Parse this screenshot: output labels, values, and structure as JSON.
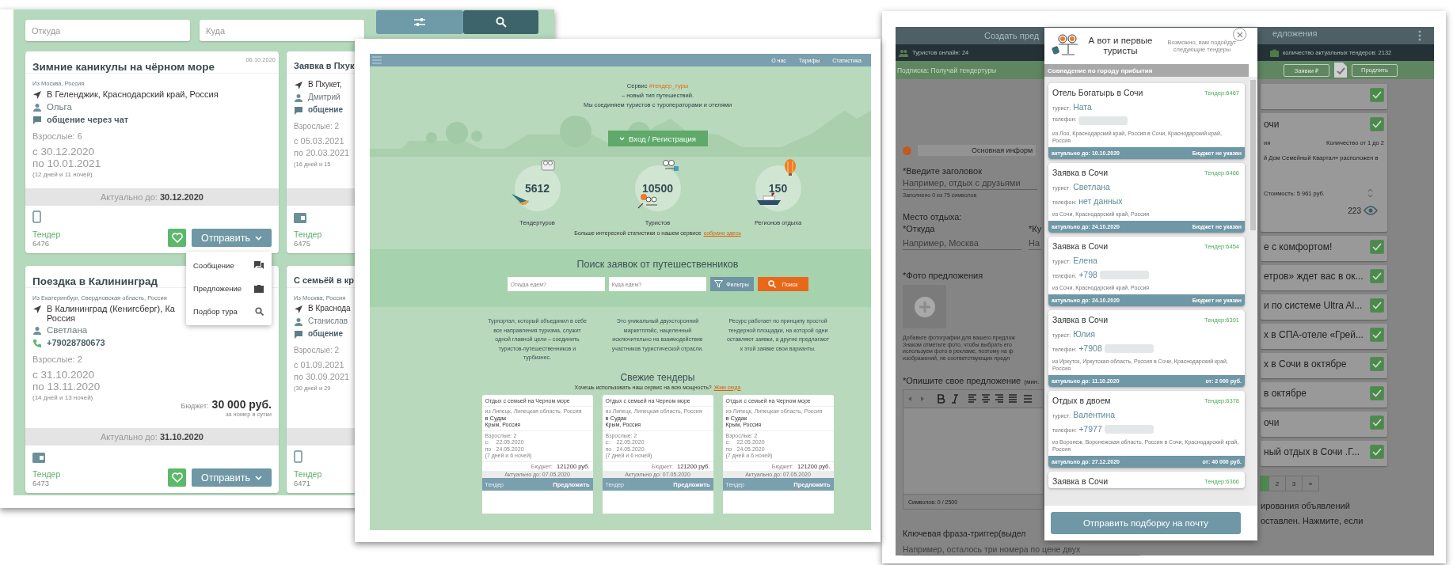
{
  "left_window": {
    "search": {
      "from_placeholder": "Откуда",
      "to_placeholder": "Куда"
    },
    "cards_column_1": [
      {
        "title": "Зимние каникулы на чёрном море",
        "date": "06.10.2020",
        "from": "Из Москва, Россия",
        "to_lines": [
          "В Геленджик, Краснодарский край, Россия"
        ],
        "tourist": "Ольга",
        "contact": {
          "kind": "chat",
          "text": "общение через чат"
        },
        "adults": "Взрослые: 6",
        "date_from": "с 30.12.2020",
        "date_to": "по 10.01.2021",
        "duration": "(12 дней и 11 ночей)",
        "actual_label": "Актуально до:",
        "actual_until": "30.12.2020",
        "source": {
          "kind": "mobile"
        },
        "tender_label": "Тендер",
        "tender_number": "6476",
        "send_label": "Отправить"
      },
      {
        "title": "Поездка в Калининград",
        "from": "Из Екатеринбург, Свердловская область, Россия",
        "to_lines": [
          "В Калининград (Кенигсберг), Ка",
          "Россия"
        ],
        "tourist": "Светлана",
        "contact": {
          "kind": "phone",
          "text": "+79028780673"
        },
        "adults": "Взрослые: 2",
        "date_from": "с 31.10.2020",
        "date_to": "по 13.11.2020",
        "duration": "(14 дней и 13 ночей)",
        "budget_label": "Бюджет:",
        "budget": "30 000 руб.",
        "budget_note": "за номер в сутки",
        "actual_label": "Актуально до:",
        "actual_until": "31.10.2020",
        "source": {
          "kind": "web"
        },
        "tender_label": "Тендер",
        "tender_number": "6473",
        "send_label": "Отправить"
      }
    ],
    "cards_column_2": [
      {
        "title": "Заявка в Пхук",
        "to_lines": [
          "В Пхукет,"
        ],
        "tourist": "Дмитрий",
        "contact": {
          "kind": "chat",
          "text": "общение"
        },
        "adults": "Взрослые: 2",
        "date_from": "с 05.03.2021",
        "date_to": "по 20.03.2021",
        "duration": "(16 дней и 15",
        "source": {
          "kind": "web"
        },
        "tender_label": "Тендер",
        "tender_number": "6475"
      },
      {
        "title": "С семьёй в кр",
        "from": "Из Москва, Россия",
        "to_lines": [
          "В Краснода"
        ],
        "tourist": "Станислав",
        "contact": {
          "kind": "chat",
          "text": "общение"
        },
        "adults": "Взрослые: 2",
        "date_from": "с 01.09.2021",
        "date_to": "по 30.09.2021",
        "duration": "(30 дней и 29",
        "source": {
          "kind": "mobile"
        },
        "tender_label": "Тендер",
        "tender_number": "6471"
      }
    ],
    "send_menu": [
      {
        "label": "Сообщение",
        "kind": "message"
      },
      {
        "label": "Предложение",
        "kind": "offer"
      },
      {
        "label": "Подбор тура",
        "kind": "search"
      }
    ]
  },
  "middle_window": {
    "nav_links": [
      "О нас",
      "Тарифы",
      "Статистика"
    ],
    "intro_prefix": "Сервис",
    "intro_tag": "#тендер_туры",
    "intro_lines": [
      "– новый тип путешествий.",
      "Мы соединяем туристов с туроператорами и отелями"
    ],
    "login_button": "Вход / Регистрация",
    "stats": [
      {
        "value": "5612",
        "label": "Тендертуров",
        "kind": "tenders"
      },
      {
        "value": "10500",
        "label": "Туристов",
        "kind": "tourists"
      },
      {
        "value": "150",
        "label": "Регионов отдыха",
        "kind": "regions"
      }
    ],
    "stats_note": "Больше интересной статистики о нашем сервисе",
    "stats_link": "собрано здесь",
    "search": {
      "title": "Поиск заявок от путешественников",
      "from_placeholder": "Откуда едем?",
      "to_placeholder": "Куда едем?",
      "filters_button": "Фильтры",
      "search_button": "Поиск"
    },
    "features": [
      "Турпортал, который объединил в себе все направления туризма, служит одной главной цели – соединить туристов-путешественников и турбизнес.",
      "Это уникальный двухсторонний маркетплэйс, нацеленный исключительно на взаимодействие участников туристической отрасли.",
      "Ресурс работает по принципу простой тендерной площадки, на которой одни оставляют заявки, а другие предлагают к этой заявке свои варианты."
    ],
    "fresh_title": "Свежие тендеры",
    "fresh_note": "Хочешь использовать наш сервис на всю мощность?",
    "fresh_link": "Жми сюда",
    "tenders": [
      {
        "title": "Отдых с семьей на Черном море",
        "from": "из Липецк, Липецкая область, Россия",
        "to": "в Судак",
        "region": "Крым, Россия",
        "adults": "Взрослые: 2",
        "from_label": "с:",
        "date_from": "22.05.2020",
        "to_label": "по",
        "date_to": "24.05.2020",
        "duration": "(7 дней и 6 ночей)",
        "budget_label": "Бюджет:",
        "budget": "121200 руб.",
        "actual": "Актуально до: 07.05.2020",
        "tender_label": "Тендер",
        "offer_button": "Предложить"
      },
      {
        "title": "Отдых с семьей на Черном море",
        "from": "из Липецк, Липецкая область, Россия",
        "to": "в Судак",
        "region": "Крым, Россия",
        "adults": "Взрослые: 2",
        "from_label": "с:",
        "date_from": "22.05.2020",
        "to_label": "по",
        "date_to": "24.05.2020",
        "duration": "(7 дней и 6 ночей)",
        "budget_label": "Бюджет:",
        "budget": "121200 руб.",
        "actual": "Актуально до: 07.05.2020",
        "tender_label": "Тендер",
        "offer_button": "Предложить"
      },
      {
        "title": "Отдых с семьей на Черном море",
        "from": "из Липецк, Липецкая область, Россия",
        "to": "в Судак",
        "region": "Крым, Россия",
        "adults": "Взрослые: 2",
        "from_label": "с:",
        "date_from": "22.05.2020",
        "to_label": "по",
        "date_to": "24.05.2020",
        "duration": "(7 дней и 6 ночей)",
        "budget_label": "Бюджет:",
        "budget": "121200 руб.",
        "actual": "Актуально до: 07.05.2020",
        "tender_label": "Тендер",
        "offer_button": "Предложить"
      }
    ]
  },
  "right_window": {
    "tabs": [
      "Создать пред",
      "едложения"
    ],
    "online": "Туристов онлайн: 24",
    "tenders_count": "количество актуальных тендеров: 2132",
    "subscription": "Подписка: Получай тендертуры",
    "requests_button": "Заявки ₽",
    "extend_button": "Продлить",
    "form": {
      "section": "Основная информ",
      "title_label": "*Введите заголовок",
      "title_placeholder": "Например, отдых с друзьями",
      "title_counter": "Заполнено 0 из 75 символов",
      "place_label": "Место отдыха:",
      "from_label": "*Откуда",
      "to_label": "*Ку",
      "from_placeholder": "Например, Москва",
      "to_placeholder": "На",
      "photo_label": "*Фото предложения",
      "photo_help": [
        "Добавьте фотографии для вашего предлож",
        "Знаком отметьте фото, чтобы выбрать его",
        "используем фото в рекламе, поэтому на ф",
        "изображений, не соответствующих предл"
      ],
      "description_label": "*Опишите свое предложение",
      "description_hint": "(мин.",
      "char_counter": "Символов: 0 / 2500",
      "keyphrase_label": "Ключевая фраза-триггер(выдел",
      "keyphrase_placeholder": "Например, осталось три номера по цене двух"
    },
    "list_items": [
      {
        "checked": true
      },
      {
        "title": "очи",
        "checked": true,
        "kind": "detailed",
        "subtitle": "ия",
        "quantity": "Количество от 1 до 2",
        "description": "й Дом Семейный Квартал» расположен в",
        "price": "Стоимость: 5 961 руб.",
        "views": "223"
      },
      {
        "title": "е с комфортом!",
        "checked": true
      },
      {
        "title": "етров» ждет вас в ок...",
        "checked": true
      },
      {
        "title": "и по системе Ultra Al...",
        "checked": true
      },
      {
        "title": "х в СПА-отеле «Грей...",
        "checked": true
      },
      {
        "title": "х в Сочи в октябре",
        "checked": true
      },
      {
        "title": "в октябре",
        "checked": true
      },
      {
        "title": "очи",
        "checked": true
      },
      {
        "title": "ный отдых в Сочи .Г...",
        "checked": true
      }
    ],
    "pages": [
      {
        "selected": true
      },
      {
        "label": "2",
        "selected": false
      },
      {
        "label": "3",
        "selected": false
      },
      {
        "label": "»",
        "selected": false
      }
    ],
    "bottom_lines": [
      "ирования объявлений",
      "оставлен. Нажмите, если"
    ],
    "modal": {
      "title": "А вот и первые туристы",
      "note": "Возможно, вам подойдут следующие тендеры",
      "section": "Совпадение по городу прибытия",
      "button": "Отправить подборку на почту",
      "cards": [
        {
          "title": "Отель Богатырь в Сочи",
          "tender": "Тендер:6467",
          "tourist_label": "турист:",
          "tourist": "Ната",
          "phone_label": "телефон:",
          "phone_blurred": true,
          "route": "из Лоо, Краснодарский край, Россия в Сочи, Краснодарский край, Россия",
          "actual": "актуально до: 10.10.2020",
          "budget": "Бюджет не указан"
        },
        {
          "title": "Заявка в Сочи",
          "tender": "Тендер:6466",
          "tourist_label": "турист:",
          "tourist": "Светлана",
          "phone_label": "телефон:",
          "phone": "нет данных",
          "phone_blurred": false,
          "route": "из Сочи, Краснодарский край, Россия",
          "actual": "актуально до: 24.10.2020",
          "budget": "Бюджет не указан"
        },
        {
          "title": "Заявка в Сочи",
          "tender": "Тендер:6454",
          "tourist_label": "турист:",
          "tourist": "Елена",
          "phone_label": "телефон:",
          "phone": "+798",
          "phone_blurred": true,
          "route": "из Сочи, Краснодарский край, Россия",
          "actual": "актуально до: 24.10.2020",
          "budget": "Бюджет не указан"
        },
        {
          "title": "Заявка в Сочи",
          "tender": "Тендер:6391",
          "tourist_label": "турист:",
          "tourist": "Юлия",
          "phone_label": "телефон:",
          "phone": "+7908",
          "phone_blurred": true,
          "route": "из Иркутск, Иркутская область, Россия в Сочи, Краснодарский край, Россия",
          "actual": "актуально до: 11.10.2020",
          "budget": "от: 2 000 руб."
        },
        {
          "title": "Отдых в двоем",
          "tender": "Тендер:6378",
          "tourist_label": "турист:",
          "tourist": "Валентина",
          "phone_label": "телефон:",
          "phone": "+7977",
          "phone_blurred": true,
          "route": "из Воронеж, Воронежская область, Россия в Сочи, Краснодарский край, Россия",
          "actual": "актуально до: 27.12.2020",
          "budget": "от: 40 000 руб."
        },
        {
          "title": "Заявка в Сочи",
          "tender": "Тендер:6366"
        }
      ]
    }
  }
}
